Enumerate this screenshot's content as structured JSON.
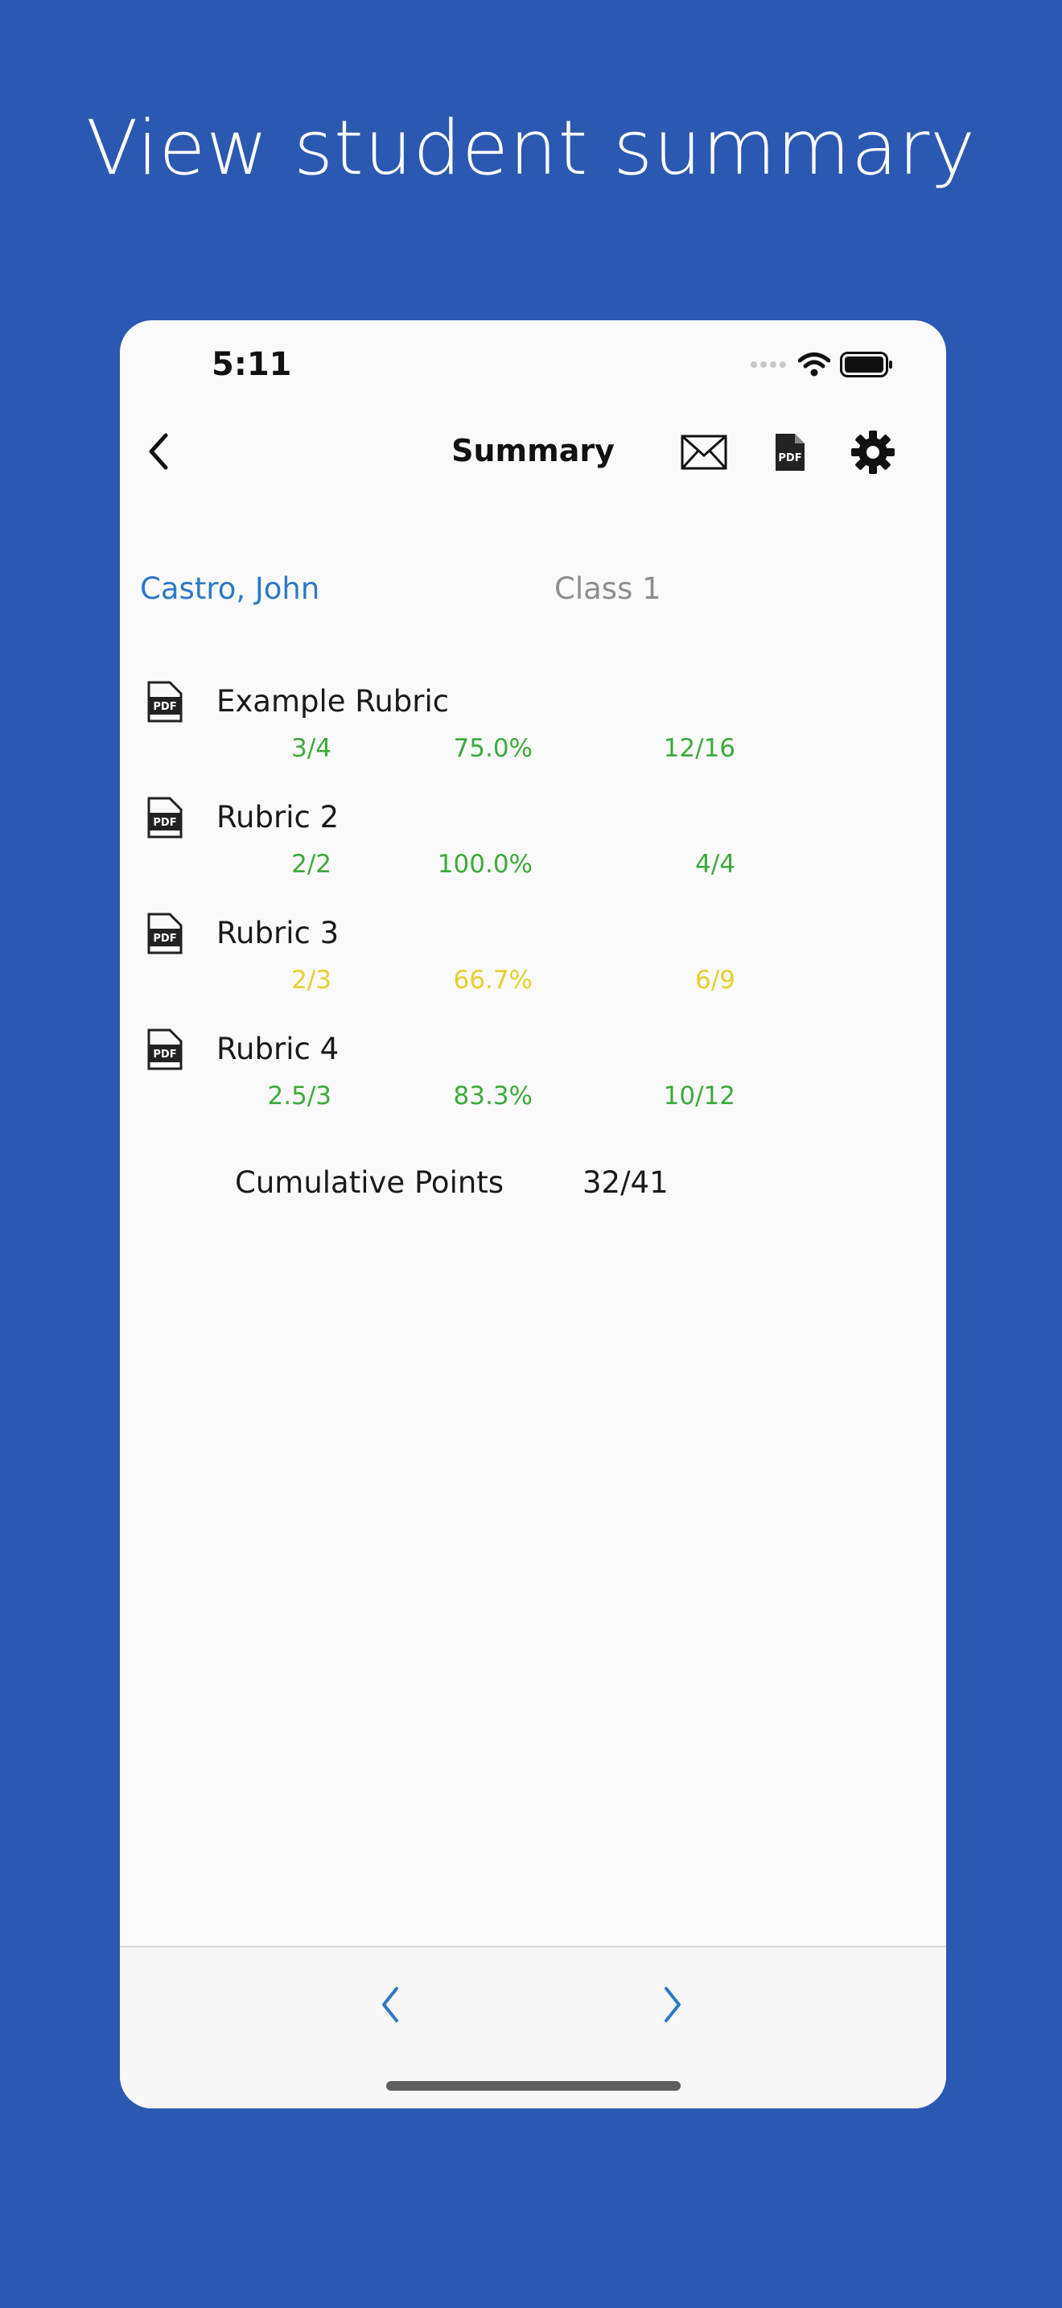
{
  "headline": "View student summary",
  "status": {
    "time": "5:11"
  },
  "nav": {
    "title": "Summary"
  },
  "student": {
    "name": "Castro, John",
    "class": "Class 1"
  },
  "rubrics": [
    {
      "name": "Example Rubric",
      "points": "3/4",
      "percent": "75.0%",
      "total": "12/16",
      "color": "#3DAA3B"
    },
    {
      "name": "Rubric 2",
      "points": "2/2",
      "percent": "100.0%",
      "total": "4/4",
      "color": "#3DAA3B"
    },
    {
      "name": "Rubric 3",
      "points": "2/3",
      "percent": "66.7%",
      "total": "6/9",
      "color": "#E6CF2E"
    },
    {
      "name": "Rubric 4",
      "points": "2.5/3",
      "percent": "83.3%",
      "total": "10/12",
      "color": "#3DAA3B"
    }
  ],
  "cumulative": {
    "label": "Cumulative Points",
    "value": "32/41"
  },
  "icons": {
    "back": "chevron-left-icon",
    "mail": "envelope-icon",
    "pdf": "pdf-file-icon",
    "settings": "gear-icon",
    "prev": "chevron-left-icon",
    "next": "chevron-right-icon"
  },
  "colors": {
    "background": "#2B59B1",
    "accent": "#2E78C7",
    "good": "#3DAA3B",
    "warning": "#E6CF2E"
  }
}
